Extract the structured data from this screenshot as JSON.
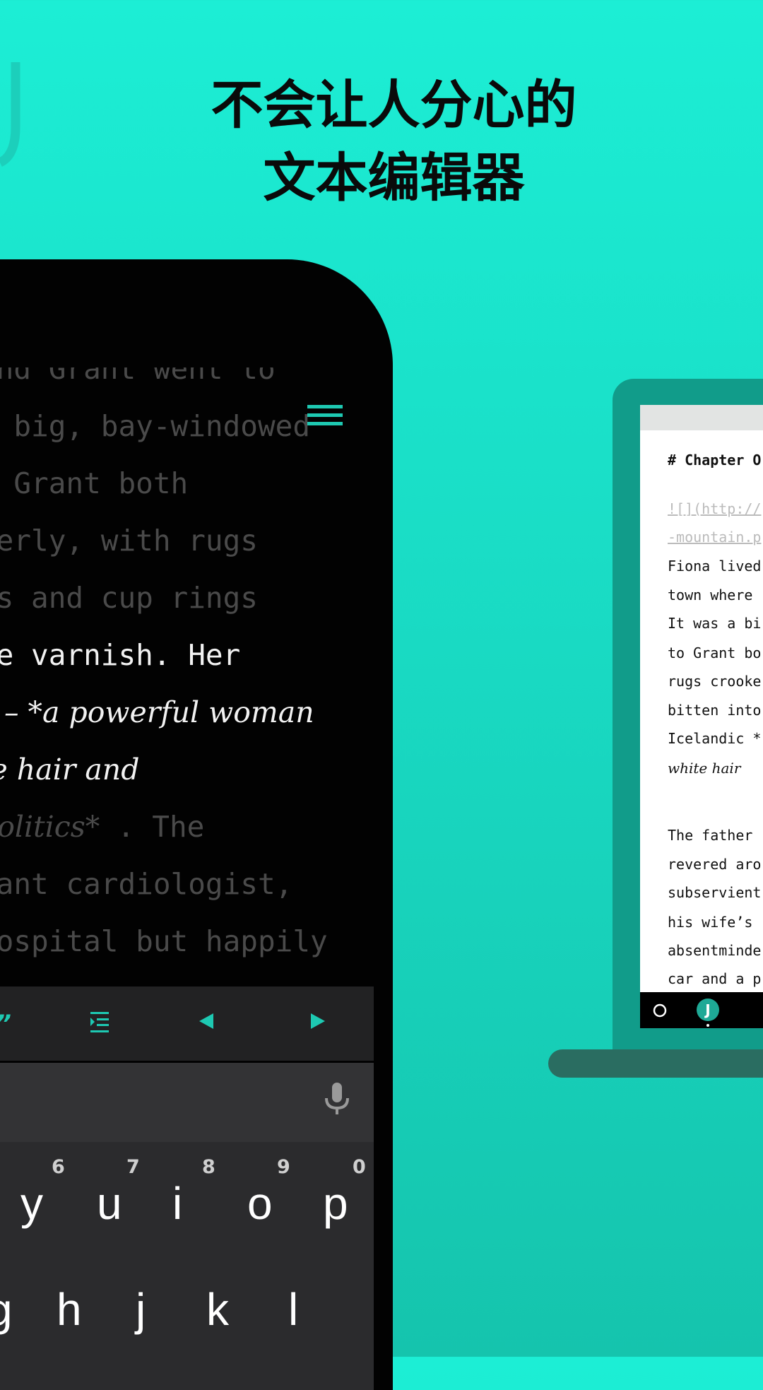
{
  "headline": {
    "line1": "不会让人分心的",
    "line2": "文本编辑器"
  },
  "colors": {
    "accent": "#1ec9b2",
    "background_top": "#1ceed5",
    "background_bottom": "#15c4ad",
    "laptop_frame": "#119c8a"
  },
  "phone": {
    "editor_lines": [
      {
        "text": "and Grant went to",
        "style": "dim"
      },
      {
        "text": "a big, bay-windowed",
        "style": "dim"
      },
      {
        "text": "o Grant both",
        "style": "dim"
      },
      {
        "text": "derly, with rugs",
        "style": "dim"
      },
      {
        "text": "es and cup rings",
        "style": "dim"
      },
      {
        "text": "he varnish. Her",
        "style": "bright"
      },
      {
        "text": "c – *a powerful woman",
        "style": "bright-italic"
      },
      {
        "text": "te hair and",
        "style": "bright-italic"
      },
      {
        "text": "politics*",
        "style": "dim-italic",
        "suffix": " . The"
      },
      {
        "text": "rant cardiologist,",
        "style": "dim"
      },
      {
        "text": "hospital but happily",
        "style": "dim"
      }
    ],
    "menu_icon": "hamburger-icon",
    "toolbar": {
      "quote": "”",
      "indent_icon": "indent-icon",
      "left_icon": "arrow-left-icon",
      "right_icon": "arrow-right-icon"
    },
    "keyboard": {
      "mic_icon": "microphone-icon",
      "row1": [
        {
          "key": "y",
          "hint": "6"
        },
        {
          "key": "u",
          "hint": "7"
        },
        {
          "key": "i",
          "hint": "8"
        },
        {
          "key": "o",
          "hint": "9"
        },
        {
          "key": "p",
          "hint": "0"
        }
      ],
      "row2": [
        "g",
        "h",
        "j",
        "k",
        "l"
      ]
    }
  },
  "laptop": {
    "lines": [
      {
        "text": "# Chapter O",
        "style": "heading"
      },
      {
        "text": "![](http://",
        "style": "link"
      },
      {
        "text": "-mountain.p",
        "style": "link"
      },
      {
        "text": "Fiona lived",
        "style": "normal"
      },
      {
        "text": "town where",
        "style": "normal"
      },
      {
        "text": "It was a bi",
        "style": "normal"
      },
      {
        "text": "to Grant bo",
        "style": "normal"
      },
      {
        "text": "rugs crooke",
        "style": "normal"
      },
      {
        "text": "bitten into",
        "style": "normal"
      },
      {
        "text": "Icelandic *",
        "style": "normal"
      },
      {
        "text": "white hair",
        "style": "italic"
      },
      {
        "text": "",
        "style": "normal"
      },
      {
        "text": "The father",
        "style": "normal"
      },
      {
        "text": "revered aro",
        "style": "normal"
      },
      {
        "text": "subservient",
        "style": "normal"
      },
      {
        "text": "his wife’s",
        "style": "normal"
      },
      {
        "text": "absentminde",
        "style": "normal"
      },
      {
        "text": "car and a p",
        "style": "normal"
      }
    ],
    "nav": {
      "home_icon": "circle-home-icon",
      "app_icon": "app-icon",
      "app_glyph": "J"
    }
  }
}
